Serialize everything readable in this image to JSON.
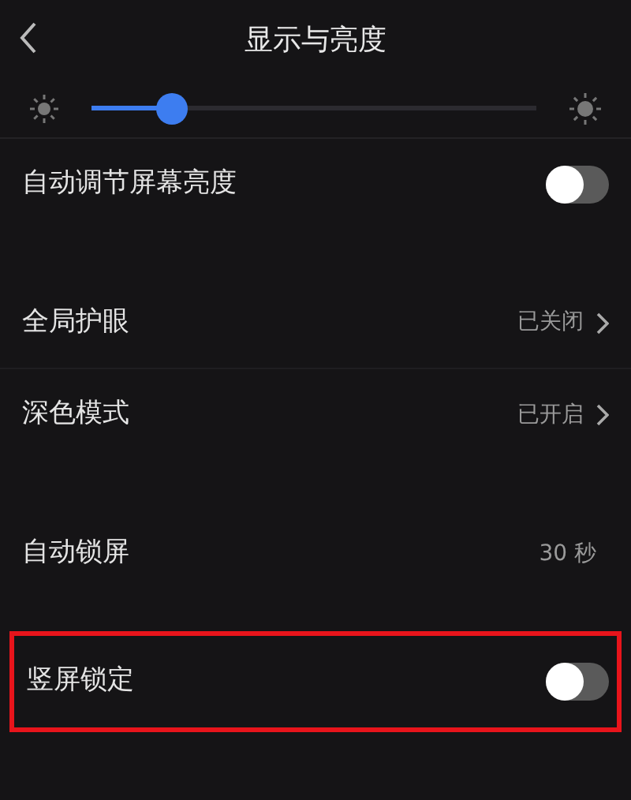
{
  "header": {
    "title": "显示与亮度"
  },
  "brightness": {
    "level": 0.18
  },
  "groups": [
    {
      "rows": [
        {
          "kind": "toggle",
          "label": "自动调节屏幕亮度",
          "on": false
        }
      ]
    },
    {
      "rows": [
        {
          "kind": "link",
          "label": "全局护眼",
          "value": "已关闭"
        },
        {
          "kind": "link",
          "label": "深色模式",
          "value": "已开启"
        }
      ]
    },
    {
      "rows": [
        {
          "kind": "value",
          "label": "自动锁屏",
          "value": "30 秒"
        }
      ]
    },
    {
      "highlighted": true,
      "rows": [
        {
          "kind": "toggle",
          "label": "竖屏锁定",
          "on": false
        }
      ]
    }
  ]
}
